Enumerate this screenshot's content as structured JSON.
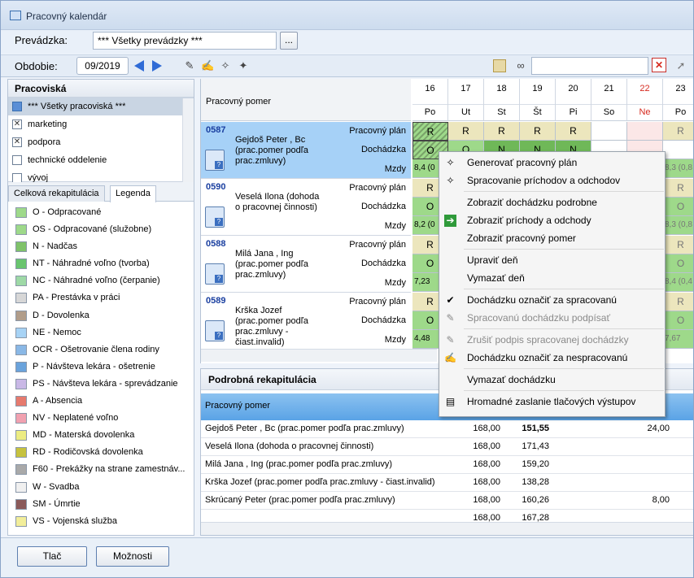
{
  "window": {
    "title": "Pracovný kalendár"
  },
  "top": {
    "prevadzka_label": "Prevádzka:",
    "prevadzka_value": "*** Všetky prevádzky ***",
    "browse_label": "...",
    "obdobie_label": "Obdobie:",
    "obdobie_value": "09/2019",
    "search_value": ""
  },
  "left": {
    "header": "Pracoviská",
    "items": [
      {
        "label": "*** Všetky pracoviská ***",
        "checked": false,
        "selected": true
      },
      {
        "label": "marketing",
        "checked": true
      },
      {
        "label": "podpora",
        "checked": true
      },
      {
        "label": "technické oddelenie",
        "checked": false
      },
      {
        "label": "vývoj",
        "checked": false
      }
    ],
    "tabs": [
      "Celková rekapitulácia",
      "Legenda"
    ],
    "legend": [
      {
        "label": "O - Odpracované",
        "color": "#9ed98a"
      },
      {
        "label": "OS - Odpracované (služobne)",
        "color": "#9ed98a"
      },
      {
        "label": "N - Nadčas",
        "color": "#7fc26a"
      },
      {
        "label": "NT - Náhradné voľno (tvorba)",
        "color": "#69c46e"
      },
      {
        "label": "NC - Náhradné voľno (čerpanie)",
        "color": "#9ed9a6"
      },
      {
        "label": "PA - Prestávka v práci",
        "color": "#d7d7d7"
      },
      {
        "label": "D - Dovolenka",
        "color": "#b19d8a"
      },
      {
        "label": "NE - Nemoc",
        "color": "#a7d3f5"
      },
      {
        "label": "OCR - Ošetrovanie člena rodiny",
        "color": "#8ab8e6"
      },
      {
        "label": "P - Návšteva lekára - ošetrenie",
        "color": "#6aa3dc"
      },
      {
        "label": "PS - Návšteva lekára - sprevádzanie",
        "color": "#c9b8e6"
      },
      {
        "label": "A - Absencia",
        "color": "#e67a6e"
      },
      {
        "label": "NV - Neplatené voľno",
        "color": "#f1a1b0"
      },
      {
        "label": "MD - Materská dovolenka",
        "color": "#ecec82"
      },
      {
        "label": "RD - Rodičovská dovolenka",
        "color": "#c6c23f"
      },
      {
        "label": "F60 - Prekážky na strane zamestnáv...",
        "color": "#a9a9a9"
      },
      {
        "label": "W - Svadba",
        "color": "#f0f0f0"
      },
      {
        "label": "SM - Úmrtie",
        "color": "#8b5a5a"
      },
      {
        "label": "VS - Vojenská služba",
        "color": "#f2ee9a"
      }
    ]
  },
  "grid": {
    "header": "Pracovný pomer",
    "days": [
      {
        "n": "16",
        "w": "Po"
      },
      {
        "n": "17",
        "w": "Ut"
      },
      {
        "n": "18",
        "w": "St"
      },
      {
        "n": "19",
        "w": "Št"
      },
      {
        "n": "20",
        "w": "Pi"
      },
      {
        "n": "21",
        "w": "So"
      },
      {
        "n": "22",
        "w": "Ne",
        "red": true
      },
      {
        "n": "23",
        "w": "Po"
      }
    ],
    "row_labels": [
      "Pracovný plán",
      "Dochádzka",
      "Mzdy"
    ],
    "employees": [
      {
        "id": "0587",
        "name": "Gejdoš Peter , Bc (prac.pomer podľa prac.zmluvy)",
        "plan": [
          "R",
          "R",
          "R",
          "R",
          "R",
          "",
          "",
          "R"
        ],
        "doch": [
          "O",
          "O",
          "N",
          "N",
          "N",
          "",
          "",
          ""
        ],
        "mzdy": [
          "8,4 (0",
          "",
          "",
          "",
          "",
          "",
          "",
          "8,3 (0,8"
        ]
      },
      {
        "id": "0590",
        "name": "Veselá Ilona (dohoda o pracovnej činnosti)",
        "plan": [
          "R",
          "",
          "",
          "",
          "",
          "",
          "",
          "R"
        ],
        "doch": [
          "O",
          "",
          "",
          "",
          "",
          "",
          "",
          "O"
        ],
        "mzdy": [
          "8,2 (0",
          "",
          "",
          "",
          "",
          "",
          "",
          "8,3 (0,8"
        ]
      },
      {
        "id": "0588",
        "name": "Milá Jana , Ing (prac.pomer podľa prac.zmluvy)",
        "plan": [
          "R",
          "",
          "",
          "",
          "",
          "",
          "",
          "R"
        ],
        "doch": [
          "O",
          "",
          "",
          "",
          "",
          "",
          "",
          "O"
        ],
        "mzdy": [
          "7,23",
          "",
          "",
          "",
          "",
          "",
          "",
          "8,4 (0,4"
        ]
      },
      {
        "id": "0589",
        "name": "Krška Jozef (prac.pomer podľa prac.zmluvy - čiast.invalid)",
        "plan": [
          "R",
          "",
          "",
          "",
          "",
          "",
          "",
          "R"
        ],
        "doch": [
          "O",
          "",
          "",
          "",
          "",
          "",
          "",
          "O"
        ],
        "mzdy": [
          "4,48",
          "",
          "",
          "",
          "",
          "",
          "",
          "7,67"
        ]
      }
    ]
  },
  "recap": {
    "title": "Podrobná rekapitulácia",
    "col_header": "Pracovný pomer",
    "rows": [
      {
        "name": "Gejdoš Peter , Bc (prac.pomer podľa prac.zmluvy)",
        "a": "168,00",
        "b": "151,55",
        "c": "24,00",
        "bold": true
      },
      {
        "name": "Veselá Ilona  (dohoda o pracovnej činnosti)",
        "a": "168,00",
        "b": "171,43",
        "c": ""
      },
      {
        "name": "Milá Jana , Ing (prac.pomer podľa prac.zmluvy)",
        "a": "168,00",
        "b": "159,20",
        "c": ""
      },
      {
        "name": "Krška Jozef  (prac.pomer podľa prac.zmluvy - čiast.invalid)",
        "a": "168,00",
        "b": "138,28",
        "c": ""
      },
      {
        "name": "Skrúcaný Peter  (prac.pomer podľa prac.zmluvy)",
        "a": "168,00",
        "b": "160,26",
        "c": "8,00"
      },
      {
        "name": "",
        "a": "168,00",
        "b": "167,28",
        "c": ""
      }
    ]
  },
  "menu": [
    {
      "label": "Generovať pracovný plán",
      "icon": "wand-icon"
    },
    {
      "label": "Spracovanie príchodov a odchodov",
      "icon": "wand-icon"
    },
    {
      "sep": true
    },
    {
      "label": "Zobraziť dochádzku podrobne"
    },
    {
      "label": "Zobraziť príchody a odchody",
      "icon": "green-arrow-icon"
    },
    {
      "label": "Zobraziť pracovný pomer"
    },
    {
      "sep": true
    },
    {
      "label": "Upraviť deň"
    },
    {
      "label": "Vymazať deň"
    },
    {
      "sep": true
    },
    {
      "label": "Dochádzku označiť za spracovanú",
      "icon": "check-icon"
    },
    {
      "label": "Spracovanú dochádzku podpísať",
      "disabled": true,
      "icon": "sign-icon"
    },
    {
      "sep": true
    },
    {
      "label": "Zrušiť podpis spracovanej dochádzky",
      "disabled": true,
      "icon": "unsign-icon"
    },
    {
      "label": "Dochádzku označiť za nespracovanú",
      "icon": "edit-icon"
    },
    {
      "sep": true
    },
    {
      "label": "Vymazať dochádzku"
    },
    {
      "sep": true
    },
    {
      "label": "Hromadné zaslanie tlačových výstupov",
      "icon": "print-icon"
    }
  ],
  "bottom": {
    "print": "Tlač",
    "options": "Možnosti"
  }
}
